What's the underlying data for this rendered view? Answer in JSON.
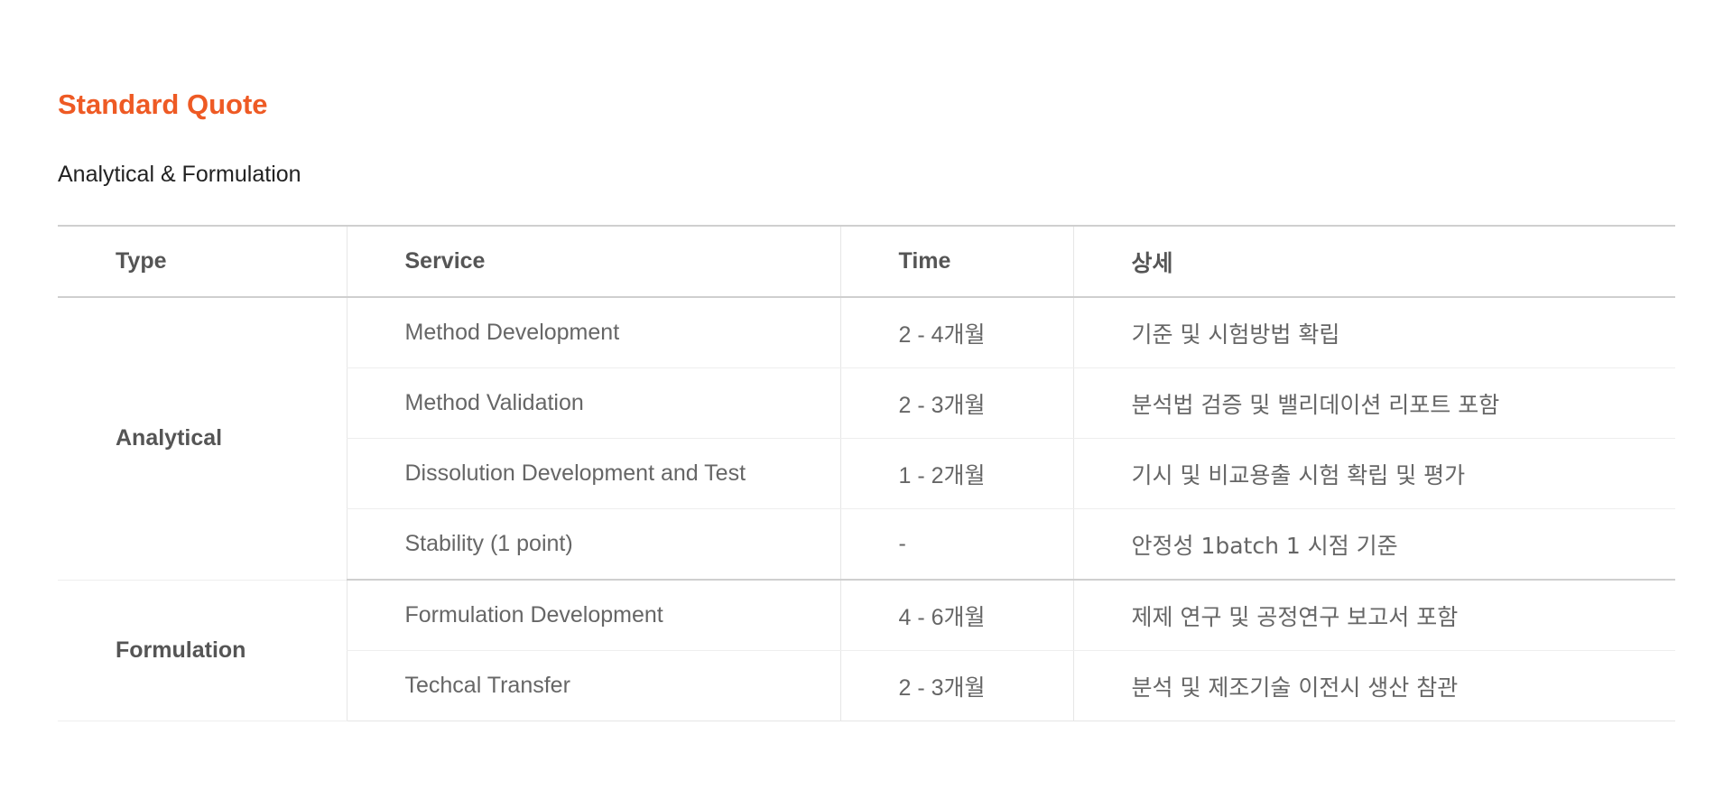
{
  "page": {
    "title": "Standard Quote",
    "subtitle": "Analytical & Formulation"
  },
  "table": {
    "headers": {
      "type": "Type",
      "service": "Service",
      "time": "Time",
      "detail": "상세"
    },
    "groups": [
      {
        "type": "Analytical",
        "rows": [
          {
            "service": "Method Development",
            "time": "2 - 4개월",
            "detail": "기준 및 시험방법 확립"
          },
          {
            "service": "Method Validation",
            "time": "2 - 3개월",
            "detail": "분석법 검증 및 밸리데이션 리포트 포함"
          },
          {
            "service": "Dissolution Development and Test",
            "time": "1 - 2개월",
            "detail": "기시 및 비교용출 시험 확립 및 평가"
          },
          {
            "service": "Stability (1 point)",
            "time": "-",
            "detail": "안정성  1batch 1 시점 기준"
          }
        ]
      },
      {
        "type": "Formulation",
        "rows": [
          {
            "service": "Formulation Development",
            "time": "4 - 6개월",
            "detail": "제제 연구 및 공정연구 보고서 포함"
          },
          {
            "service": "Techcal Transfer",
            "time": "2 - 3개월",
            "detail": "분석 및 제조기술 이전시 생산 참관"
          }
        ]
      }
    ]
  },
  "colors": {
    "accent": "#ee5a24",
    "text": "#555555",
    "rule": "#cfcfcf"
  }
}
